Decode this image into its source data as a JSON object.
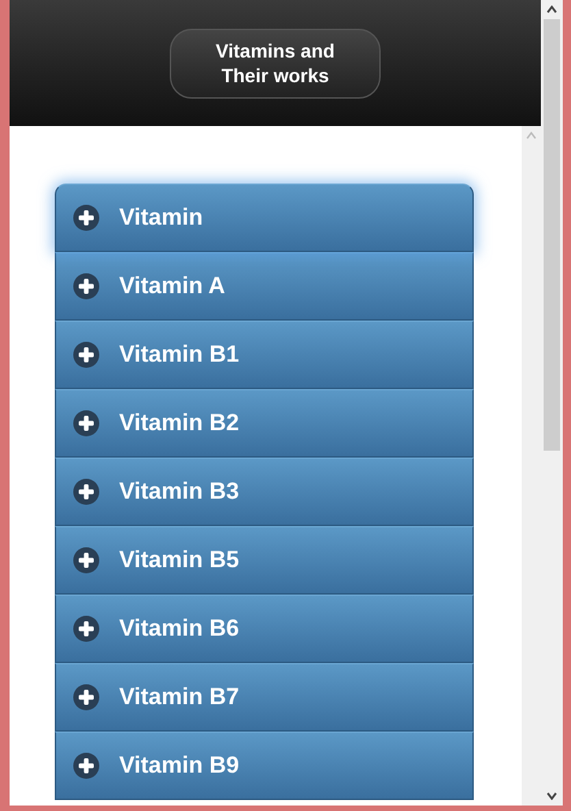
{
  "header": {
    "title_lines": [
      "Vitamins and",
      "Their works"
    ]
  },
  "items": [
    {
      "label": "Vitamin",
      "expanded": false,
      "focused": true
    },
    {
      "label": "Vitamin A",
      "expanded": false,
      "focused": false
    },
    {
      "label": "Vitamin B1",
      "expanded": false,
      "focused": false
    },
    {
      "label": "Vitamin B2",
      "expanded": false,
      "focused": false
    },
    {
      "label": "Vitamin B3",
      "expanded": false,
      "focused": false
    },
    {
      "label": "Vitamin B5",
      "expanded": false,
      "focused": false
    },
    {
      "label": "Vitamin B6",
      "expanded": false,
      "focused": false
    },
    {
      "label": "Vitamin B7",
      "expanded": false,
      "focused": false
    },
    {
      "label": "Vitamin B9",
      "expanded": false,
      "focused": false
    }
  ]
}
